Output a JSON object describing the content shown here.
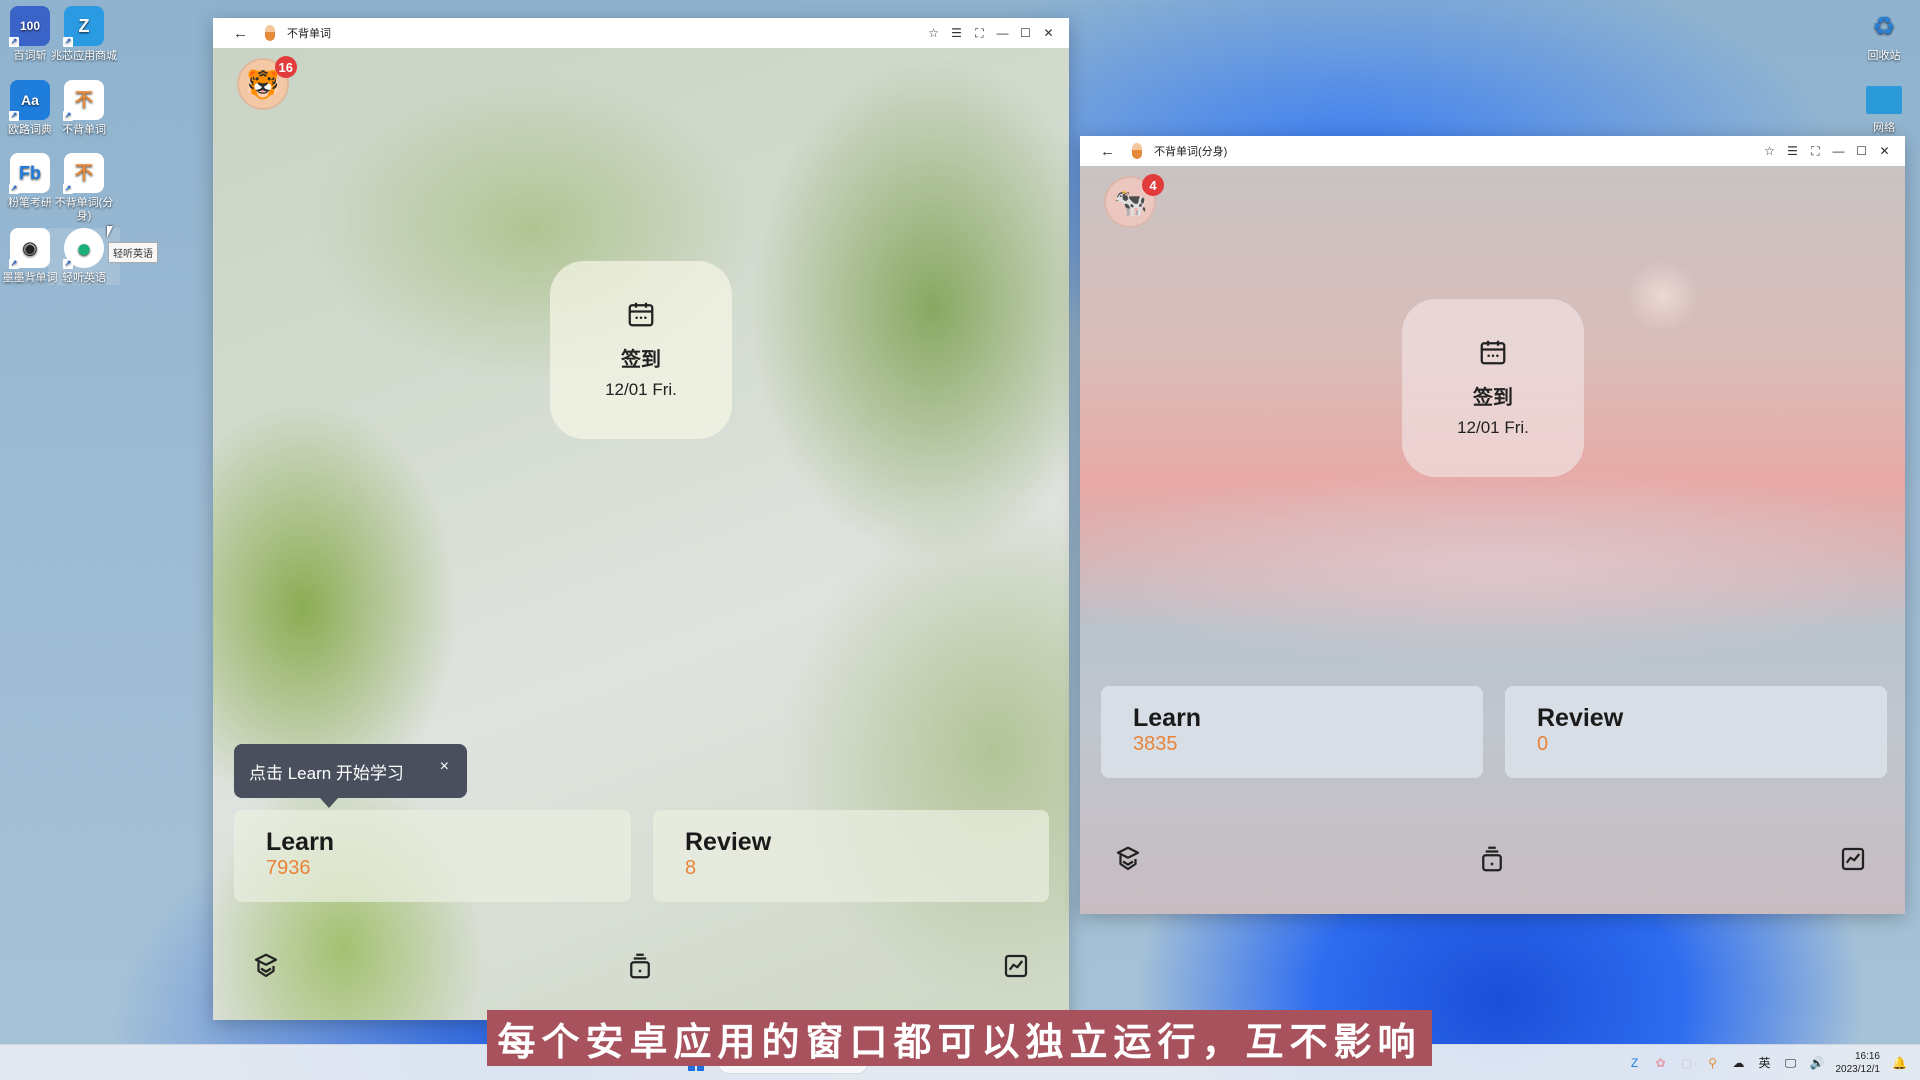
{
  "desktop": {
    "icons_left": [
      {
        "label": "百词斩",
        "icon": "baicizhan-icon",
        "color": "#3b64c9",
        "glyph": "100"
      },
      {
        "label": "兆芯应用商城",
        "icon": "app-store-icon",
        "color": "#2a9be3",
        "glyph": "Z"
      },
      {
        "label": "欧路词典",
        "icon": "eudic-icon",
        "color": "#1f7ddb",
        "glyph": "Aa"
      },
      {
        "label": "不背单词",
        "icon": "bubei-icon",
        "color": "#ffffff",
        "glyph": "不"
      },
      {
        "label": "粉笔考研",
        "icon": "fenbi-icon",
        "color": "#ffffff",
        "glyph": "Fb"
      },
      {
        "label": "不背单词(分身)",
        "icon": "bubei-clone-icon",
        "color": "#ffffff",
        "glyph": "不"
      },
      {
        "label": "墨墨背单词",
        "icon": "momo-icon",
        "color": "#ffffff",
        "glyph": "◉"
      },
      {
        "label": "轻听英语",
        "icon": "qingting-icon",
        "color": "#ffffff",
        "glyph": "●"
      }
    ],
    "icons_right": [
      {
        "label": "回收站",
        "icon": "recycle-bin-icon"
      },
      {
        "label": "网络",
        "icon": "network-icon"
      }
    ],
    "hover_tooltip": "轻听英语"
  },
  "window_main": {
    "title": "不背单词",
    "controls": [
      "pin",
      "menu",
      "fullscreen",
      "minimize",
      "maximize",
      "close"
    ],
    "avatar_badge": "16",
    "checkin": {
      "label": "签到",
      "date": "12/01 Fri."
    },
    "guide_tip": "点击 Learn 开始学习",
    "guide_close": "×",
    "learn": {
      "label": "Learn",
      "count": "7936"
    },
    "review": {
      "label": "Review",
      "count": "8"
    },
    "nav": [
      "study-icon",
      "word-box-icon",
      "stats-icon"
    ]
  },
  "window_clone": {
    "title": "不背单词(分身)",
    "controls": [
      "pin",
      "menu",
      "fullscreen",
      "minimize",
      "maximize",
      "close"
    ],
    "avatar_badge": "4",
    "checkin": {
      "label": "签到",
      "date": "12/01 Fri."
    },
    "learn": {
      "label": "Learn",
      "count": "3835"
    },
    "review": {
      "label": "Review",
      "count": "0"
    },
    "nav": [
      "study-icon",
      "word-box-icon",
      "stats-icon"
    ]
  },
  "subtitle": "每个安卓应用的窗口都可以独立运行，互不影响",
  "taskbar": {
    "tray": {
      "ime": "英",
      "time": "16:16",
      "date": "2023/12/1"
    }
  },
  "colors": {
    "accent_count": "#e8843a",
    "badge": "#e23b3b",
    "guide_bg": "#494f5c",
    "subtitle_bg": "#a7525c"
  }
}
